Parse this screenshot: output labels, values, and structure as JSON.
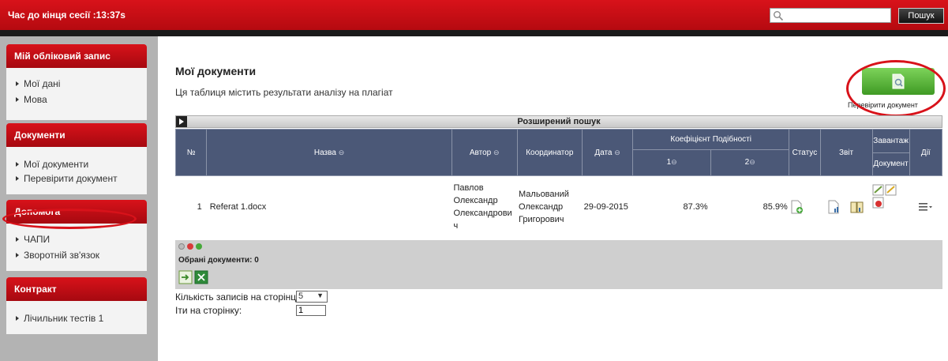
{
  "header": {
    "session_label": "Час до кінця сесії :13:37s",
    "search_placeholder": "",
    "search_button": "Пошук"
  },
  "sidebar": {
    "account": {
      "title": "Мій обліковий запис",
      "items": [
        "Мої дані",
        "Мова"
      ]
    },
    "documents": {
      "title": "Документи",
      "items": [
        "Мої документи",
        "Перевірити документ"
      ]
    },
    "help": {
      "title": "Допомога",
      "items": [
        "ЧАПИ",
        "Зворотній зв'язок"
      ]
    },
    "contract": {
      "title": "Контракт",
      "items": [
        "Лічильник тестів 1"
      ]
    }
  },
  "main": {
    "title": "Мої документи",
    "subtitle": "Ця таблиця містить результати аналізу на плагіат",
    "check_button_label": "Перевірити документ",
    "advanced_search": "Розширений пошук",
    "table": {
      "headers": {
        "num": "№",
        "name": "Назва",
        "author": "Автор",
        "coordinator": "Координатор",
        "date": "Дата",
        "similarity": "Коефіцієнт Подібності",
        "sim1": "1",
        "sim2": "2",
        "status": "Статус",
        "report": "Звіт",
        "download1": "Завантаж",
        "download2": "Документ",
        "actions": "Дії"
      },
      "rows": [
        {
          "num": "1",
          "name": "Referat 1.docx",
          "author1": "Павлов",
          "author2": "Олександр",
          "author3": "Олександрови",
          "author4": "ч",
          "coord1": "Мальований",
          "coord2": "Олександр",
          "coord3": "Григорович",
          "date": "29-09-2015",
          "sim1": "87.3%",
          "sim2": "85.9%"
        }
      ]
    },
    "selected_label": "Обрані документи:",
    "selected_count": "0",
    "per_page_label": "Кількість записів на сторінці:",
    "per_page_value": "5",
    "goto_label": "Іти на сторінку:",
    "goto_value": "1"
  }
}
